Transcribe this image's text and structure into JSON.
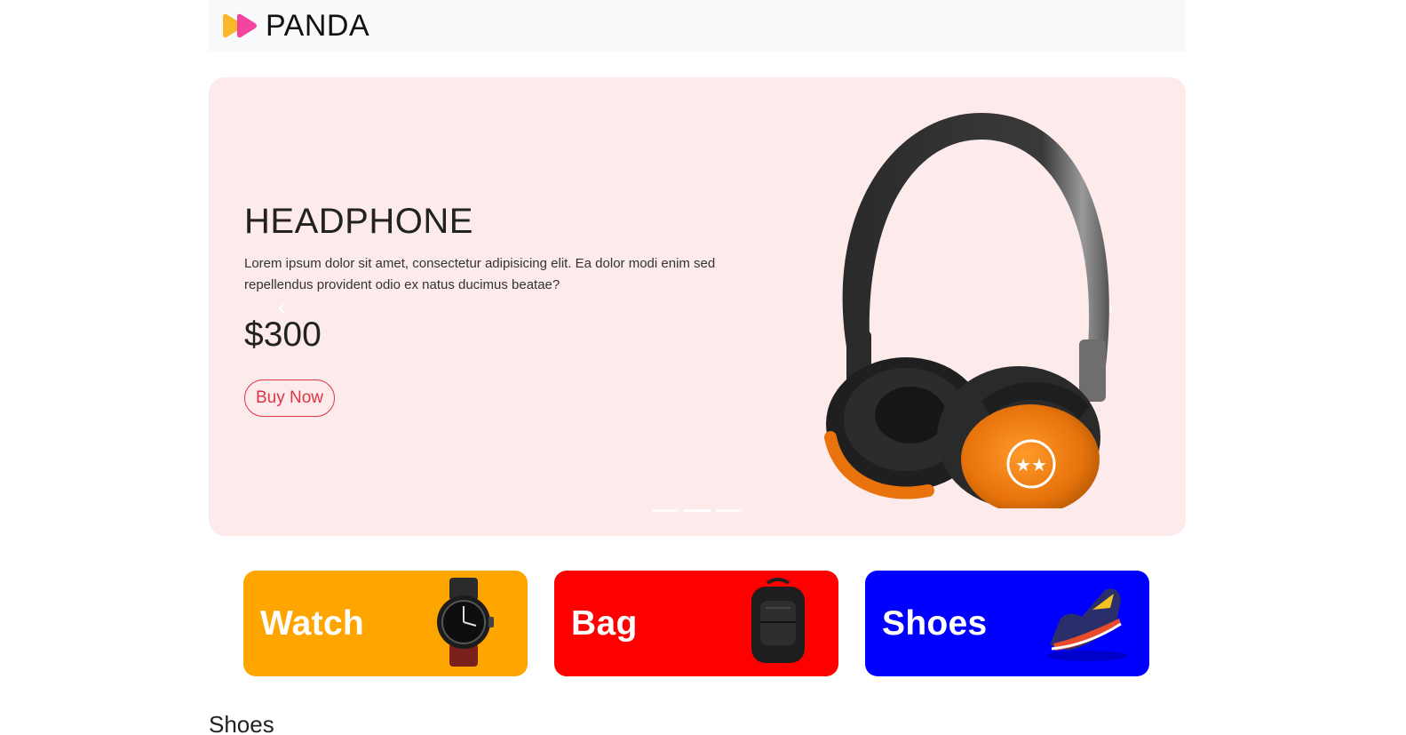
{
  "brand": {
    "name": "PANDA",
    "logo_icon": "play-arrows-logo-icon",
    "logo_colors": [
      "#f9b82b",
      "#f23a9b"
    ]
  },
  "hero": {
    "title": "HEADPHONE",
    "description": "Lorem ipsum dolor sit amet, consectetur adipisicing elit. Ea dolor modi enim sed repellendus provident odio ex natus ducimus beatae?",
    "price": "$300",
    "button_label": "Buy Now",
    "prev_icon": "chevron-left-icon",
    "next_icon": "chevron-right-icon",
    "prev_glyph": "‹",
    "next_glyph": "›",
    "slides_count": 3,
    "active_slide": 2,
    "background": "#fdeaea",
    "accent": "#dc3545",
    "image": "headphone-image"
  },
  "categories": [
    {
      "label": "Watch",
      "color": "#ffa500",
      "image": "watch-image"
    },
    {
      "label": "Bag",
      "color": "#ff0000",
      "image": "backpack-image"
    },
    {
      "label": "Shoes",
      "color": "#0000ff",
      "image": "sneaker-image"
    }
  ],
  "section": {
    "title": "Shoes"
  }
}
